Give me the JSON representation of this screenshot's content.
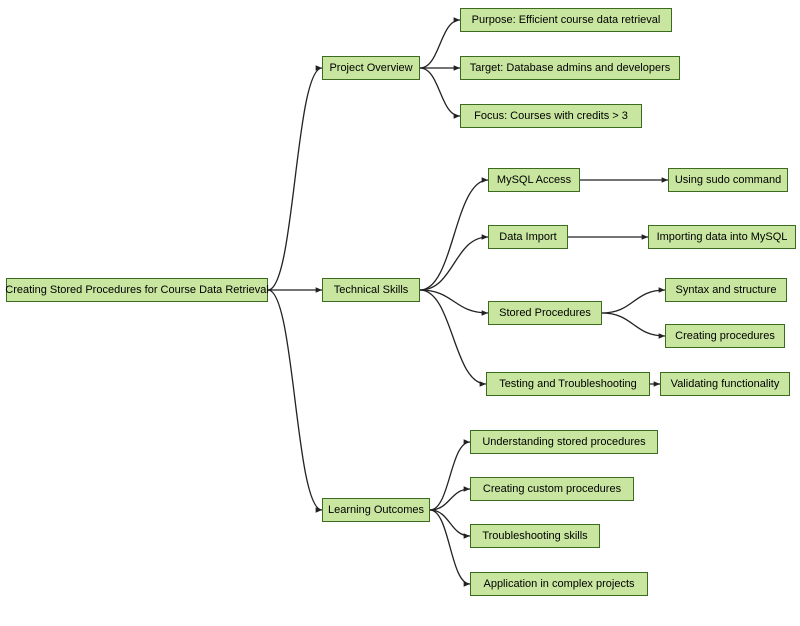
{
  "chart_data": {
    "type": "tree",
    "title": null,
    "nodes": {
      "root": "Creating Stored Procedures for Course Data Retrieval",
      "overview": "Project Overview",
      "overview_children": [
        "Purpose: Efficient course data retrieval",
        "Target: Database admins and developers",
        "Focus: Courses with credits > 3"
      ],
      "skills": "Technical Skills",
      "skills_children": {
        "mysql_access": "MySQL Access",
        "mysql_access_children": [
          "Using sudo command"
        ],
        "data_import": "Data Import",
        "data_import_children": [
          "Importing data into MySQL"
        ],
        "stored_proc": "Stored Procedures",
        "stored_proc_children": [
          "Syntax and structure",
          "Creating procedures"
        ],
        "testing": "Testing and Troubleshooting",
        "testing_children": [
          "Validating functionality"
        ]
      },
      "outcomes": "Learning Outcomes",
      "outcomes_children": [
        "Understanding stored procedures",
        "Creating custom procedures",
        "Troubleshooting skills",
        "Application in complex projects"
      ]
    }
  },
  "colors": {
    "node_fill": "#c8e6a0",
    "node_border": "#3b6b1f",
    "edge": "#222222"
  }
}
